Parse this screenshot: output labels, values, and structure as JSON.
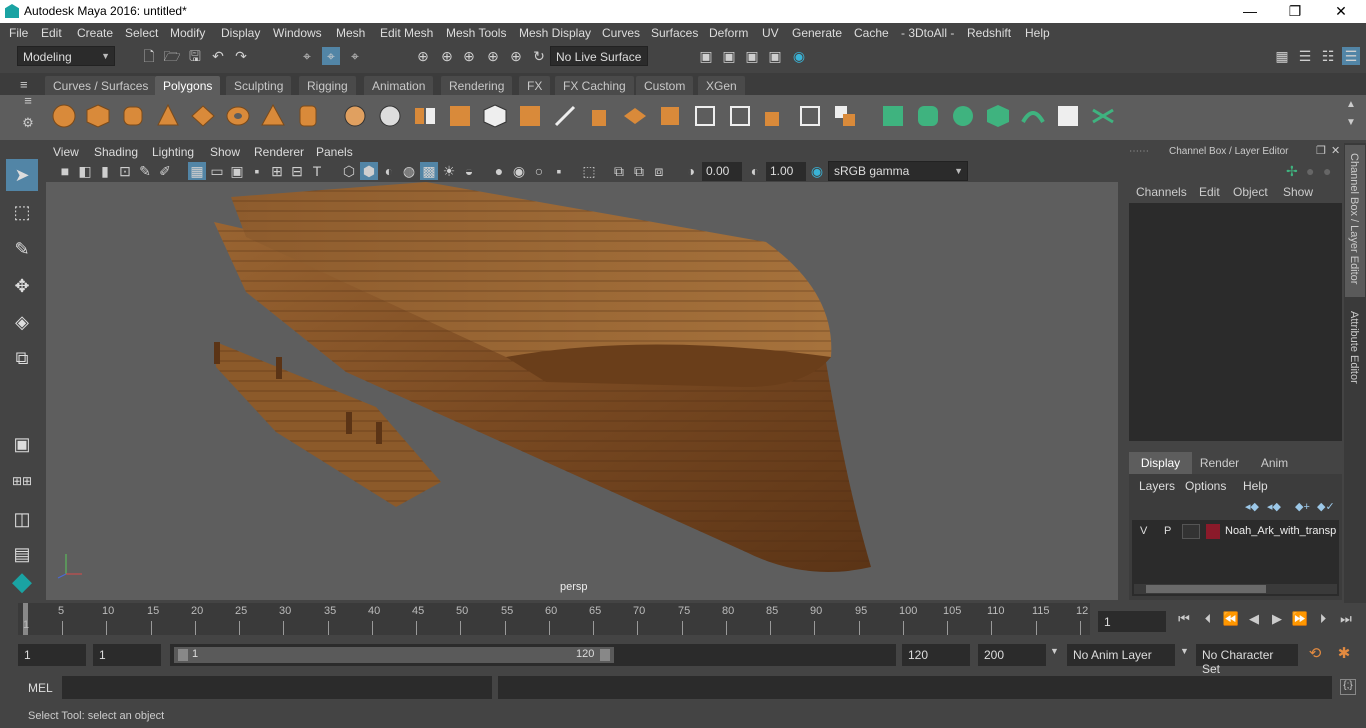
{
  "window": {
    "title": "Autodesk Maya 2016: untitled*",
    "min": "—",
    "max": "❐",
    "close": "✕"
  },
  "menubar": [
    "File",
    "Edit",
    "Create",
    "Select",
    "Modify",
    "Display",
    "Windows",
    "Mesh",
    "Edit Mesh",
    "Mesh Tools",
    "Mesh Display",
    "Curves",
    "Surfaces",
    "Deform",
    "UV",
    "Generate",
    "Cache",
    "- 3DtoAll -",
    "Redshift",
    "Help"
  ],
  "status": {
    "mode": "Modeling",
    "live_surface": "No Live Surface"
  },
  "shelf_tabs": [
    "Curves / Surfaces",
    "Polygons",
    "Sculpting",
    "Rigging",
    "Animation",
    "Rendering",
    "FX",
    "FX Caching",
    "Custom",
    "XGen"
  ],
  "shelf_active": "Polygons",
  "viewport": {
    "menu": [
      "View",
      "Shading",
      "Lighting",
      "Show",
      "Renderer",
      "Panels"
    ],
    "exposure": "0.00",
    "gamma": "1.00",
    "colorspace": "sRGB gamma",
    "camera_label": "persp"
  },
  "channel_box": {
    "title": "Channel Box / Layer Editor",
    "menu": [
      "Channels",
      "Edit",
      "Object",
      "Show"
    ],
    "layer_tabs": [
      "Display",
      "Render",
      "Anim"
    ],
    "layer_menu": [
      "Layers",
      "Options",
      "Help"
    ],
    "layer": {
      "v": "V",
      "p": "P",
      "name": "Noah_Ark_with_transp",
      "color": "#8b1a2a"
    }
  },
  "side_tabs": [
    "Channel Box / Layer Editor",
    "Attribute Editor"
  ],
  "timeline": {
    "ticks": [
      "5",
      "10",
      "15",
      "20",
      "25",
      "30",
      "35",
      "40",
      "45",
      "50",
      "55",
      "60",
      "65",
      "70",
      "75",
      "80",
      "85",
      "90",
      "95",
      "100",
      "105",
      "110",
      "115",
      "12"
    ],
    "start_tick": "1",
    "current_frame": "1"
  },
  "range": {
    "start": "1",
    "anim_start": "1",
    "slider_start": "1",
    "slider_end": "120",
    "end": "120",
    "anim_end": "200",
    "anim_layer": "No Anim Layer",
    "char_set": "No Character Set"
  },
  "mel": {
    "label": "MEL"
  },
  "help_line": "Select Tool: select an object",
  "colors": {
    "accent": "#5285a6",
    "wood": "#8a5a2b",
    "shelf_orange": "#d98a3a",
    "shelf_green": "#3fb37f"
  }
}
